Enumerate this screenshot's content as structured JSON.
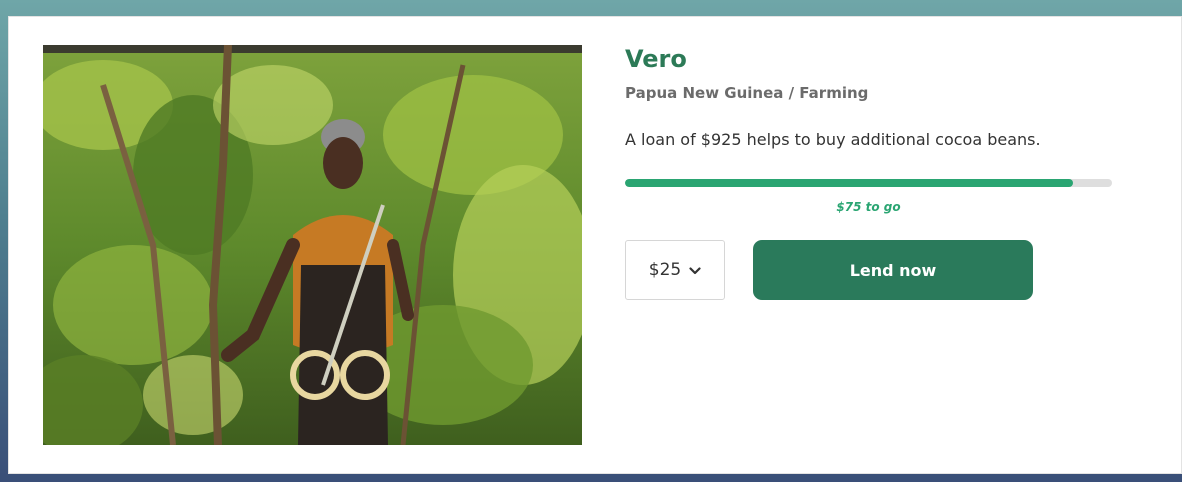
{
  "loan": {
    "borrower_name": "Vero",
    "location_sector": "Papua New Guinea / Farming",
    "description": "A loan of $925 helps to buy additional cocoa beans.",
    "funded_fraction": 0.92,
    "remaining_text": "$75 to go"
  },
  "actions": {
    "amount_selected": "$25",
    "amount_icon": "chevron-down-icon",
    "lend_label": "Lend now"
  },
  "colors": {
    "accent": "#2c7a57",
    "progress": "#2aa572",
    "button": "#2a7a5b"
  }
}
